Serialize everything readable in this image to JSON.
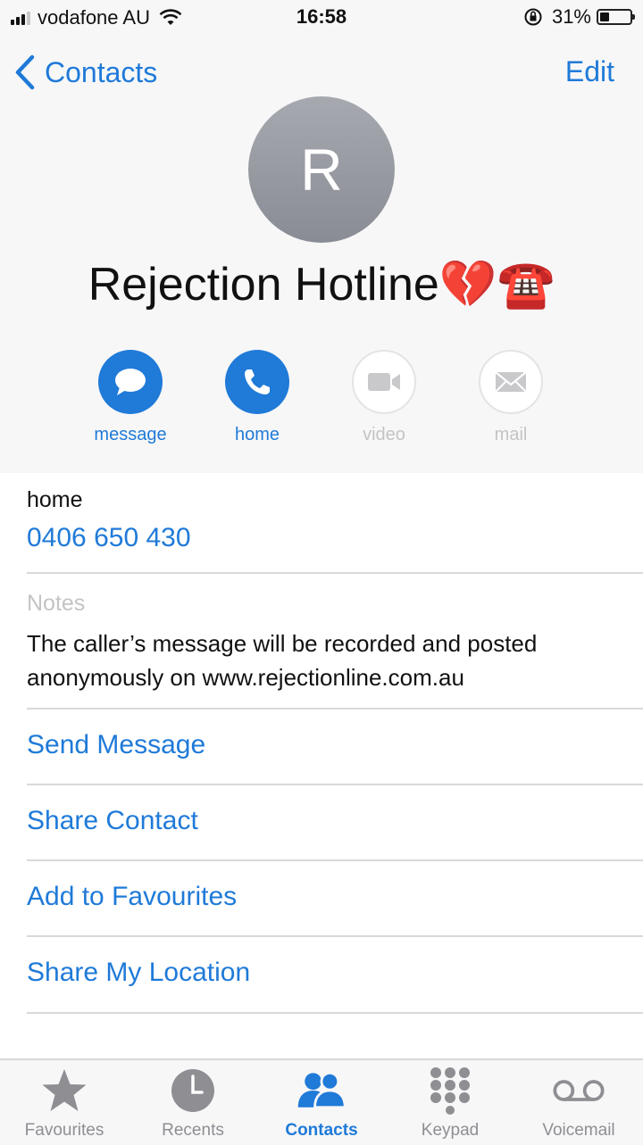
{
  "status_bar": {
    "carrier": "vodafone AU",
    "time": "16:58",
    "battery_percent": "31%",
    "battery_level": 0.31
  },
  "nav": {
    "back_label": "Contacts",
    "edit_label": "Edit"
  },
  "contact": {
    "initial": "R",
    "name": "Rejection Hotline💔☎️",
    "icons": [
      "broken-heart-icon",
      "telephone-icon"
    ]
  },
  "actions": [
    {
      "label": "message",
      "icon": "message-bubble-icon",
      "enabled": true
    },
    {
      "label": "home",
      "icon": "phone-icon",
      "enabled": true
    },
    {
      "label": "video",
      "icon": "video-camera-icon",
      "enabled": false
    },
    {
      "label": "mail",
      "icon": "mail-envelope-icon",
      "enabled": false
    }
  ],
  "phone": {
    "label": "home",
    "number": "0406 650 430"
  },
  "notes": {
    "label": "Notes",
    "text": "The caller’s message will be recorded and posted anonymously on www.rejectionline.com.au"
  },
  "links": [
    "Send Message",
    "Share Contact",
    "Add to Favourites",
    "Share My Location"
  ],
  "tabs": [
    {
      "label": "Favourites",
      "icon": "star-icon",
      "active": false
    },
    {
      "label": "Recents",
      "icon": "clock-icon",
      "active": false
    },
    {
      "label": "Contacts",
      "icon": "contacts-icon",
      "active": true
    },
    {
      "label": "Keypad",
      "icon": "keypad-icon",
      "active": false
    },
    {
      "label": "Voicemail",
      "icon": "voicemail-icon",
      "active": false
    }
  ],
  "colors": {
    "accent": "#1f7ad8",
    "disabled": "#c4c4c6",
    "header_bg": "#f7f7f8"
  }
}
